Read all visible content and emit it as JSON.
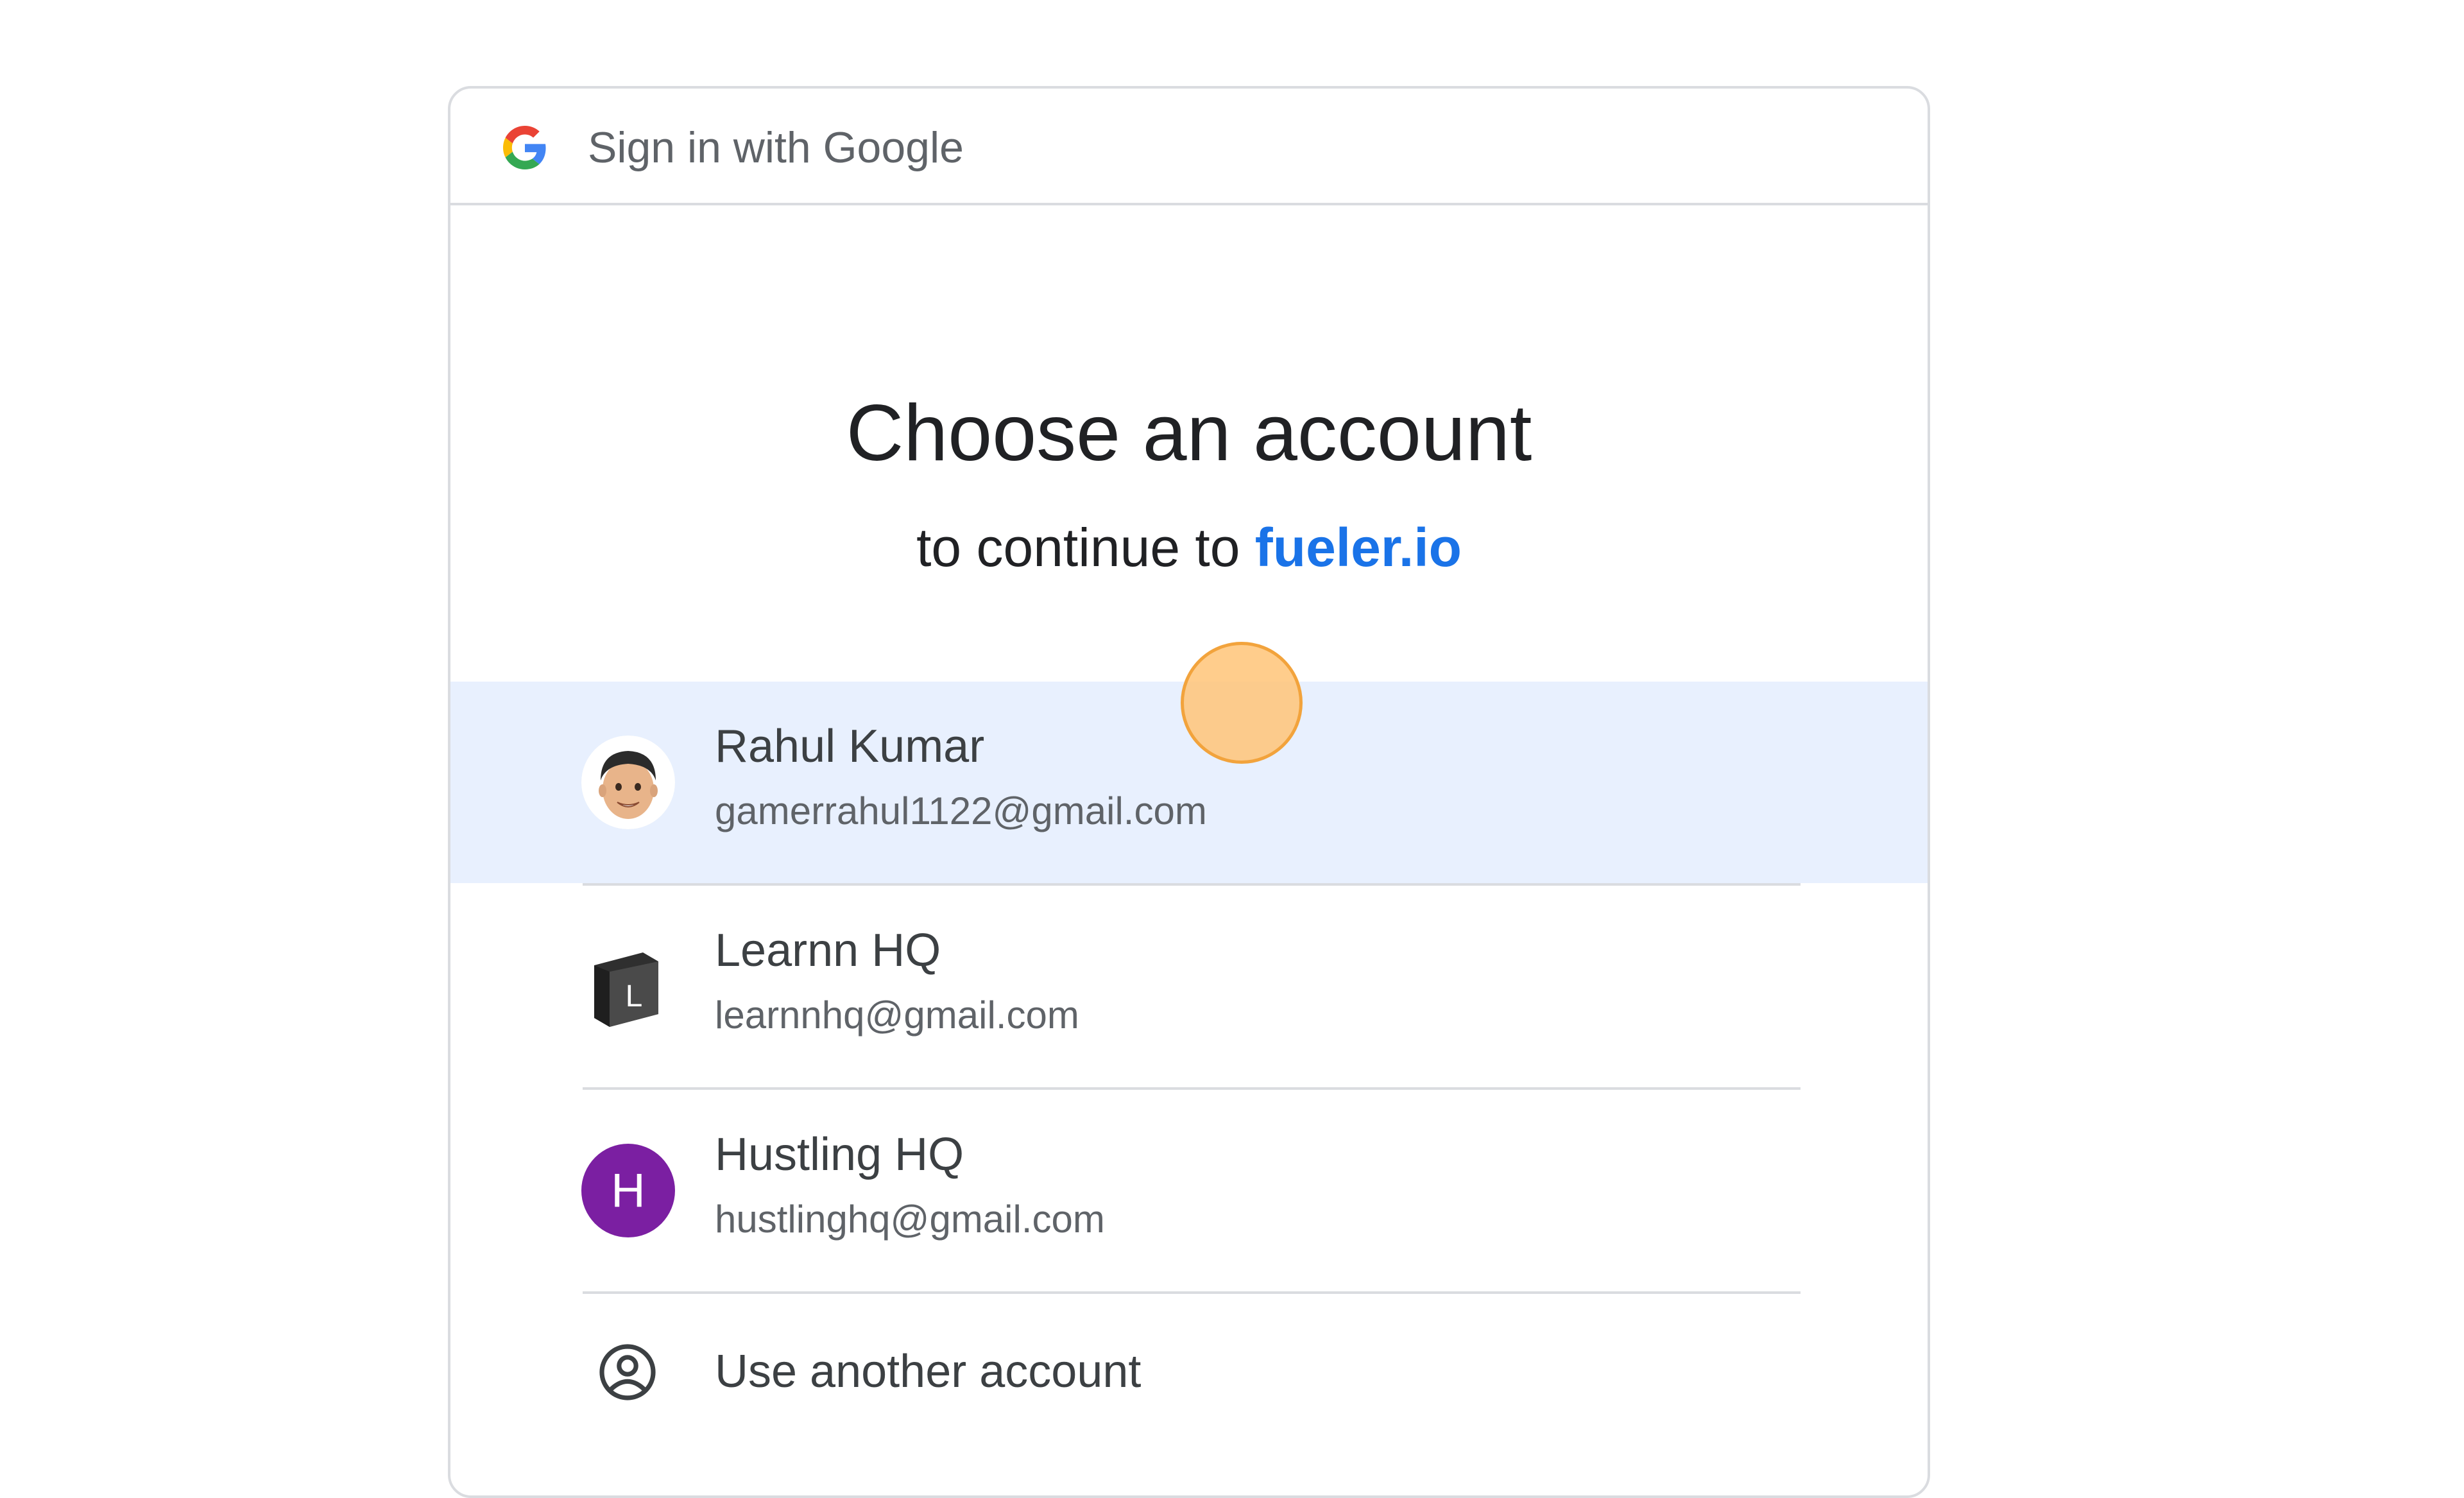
{
  "header": {
    "logo_icon": "google-g-icon",
    "title": "Sign in with Google"
  },
  "main": {
    "title": "Choose an account",
    "subtitle_prefix": "to continue to",
    "subtitle_link": "fueler.io"
  },
  "accounts": [
    {
      "name": "Rahul Kumar",
      "email": "gamerrahul1122@gmail.com",
      "avatar": "memoji-avatar",
      "highlighted": true
    },
    {
      "name": "Learnn HQ",
      "email": "learnnhq@gmail.com",
      "avatar": "learnn-logo"
    },
    {
      "name": "Hustling HQ",
      "email": "hustlinghq@gmail.com",
      "avatar": "letter-avatar",
      "avatar_letter": "H",
      "avatar_color": "#7b1fa2"
    }
  ],
  "other_account": {
    "label": "Use another account",
    "icon": "account-circle-icon"
  },
  "colors": {
    "link": "#1a73e8",
    "highlight": "#e8f0fe",
    "border": "#dadce0",
    "click_indicator": "#f2a33c"
  }
}
